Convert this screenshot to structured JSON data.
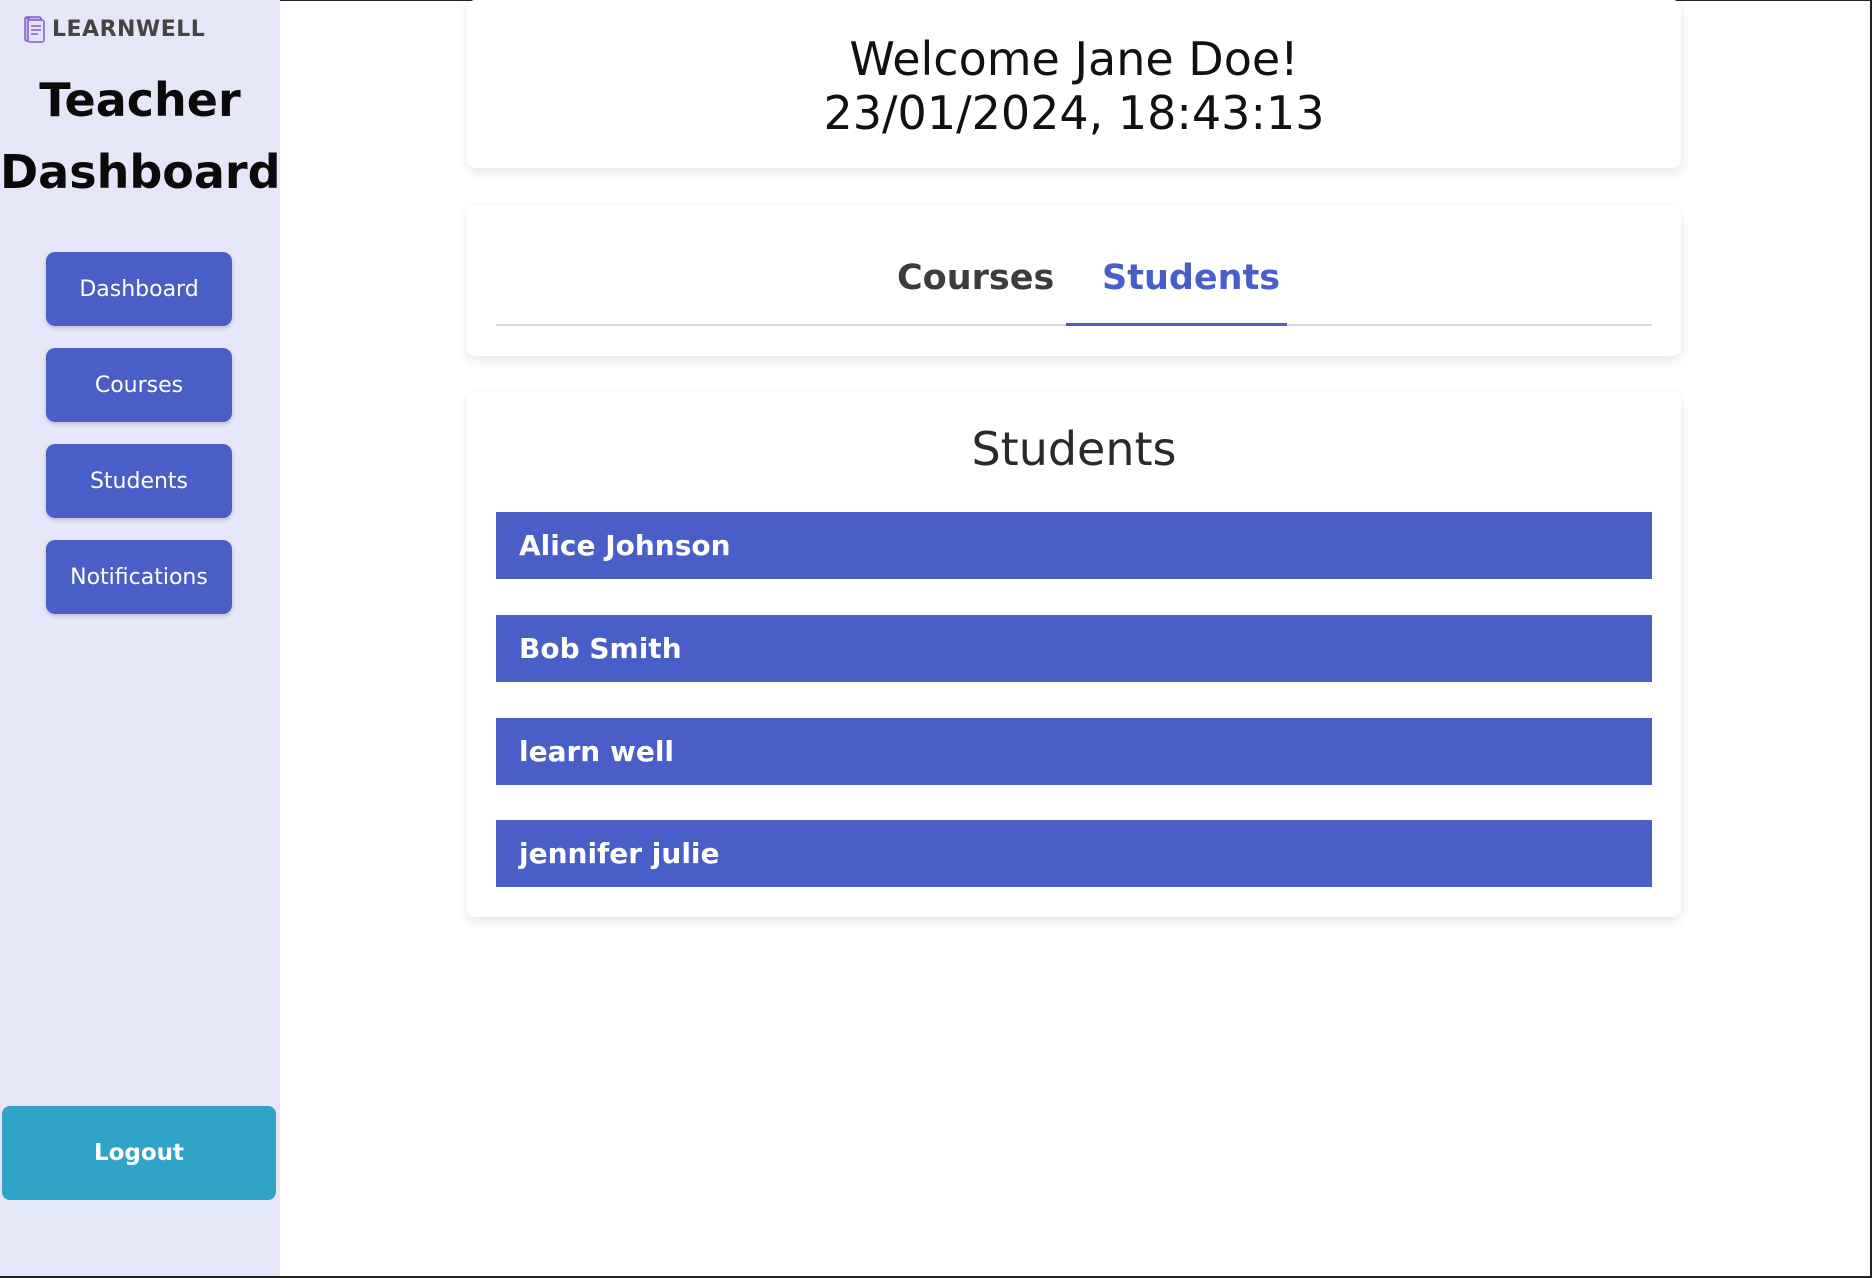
{
  "brand": {
    "name": "LEARNWELL",
    "icon": "notebook-icon"
  },
  "sidebar": {
    "title_line1": "Teacher",
    "title_line2": "Dashboard",
    "items": [
      {
        "label": "Dashboard"
      },
      {
        "label": "Courses"
      },
      {
        "label": "Students"
      },
      {
        "label": "Notifications"
      }
    ],
    "logout_label": "Logout"
  },
  "header": {
    "welcome": "Welcome Jane Doe!",
    "datetime": "23/01/2024, 18:43:13"
  },
  "tabs": {
    "items": [
      {
        "label": "Courses",
        "active": false
      },
      {
        "label": "Students",
        "active": true
      }
    ]
  },
  "students_section": {
    "title": "Students",
    "students": [
      {
        "name": "Alice Johnson"
      },
      {
        "name": "Bob Smith"
      },
      {
        "name": "learn well"
      },
      {
        "name": "jennifer julie"
      }
    ]
  },
  "colors": {
    "sidebar_bg": "#e6e6f9",
    "accent": "#4a5ec8",
    "logout": "#30a3c8"
  }
}
